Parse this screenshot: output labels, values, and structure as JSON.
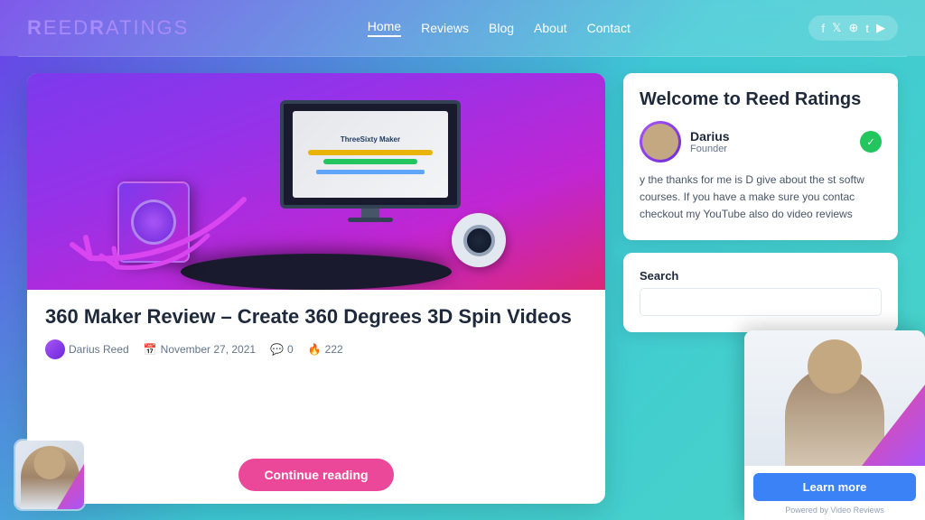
{
  "header": {
    "logo_text": "ReedRatings",
    "nav_items": [
      {
        "label": "Home",
        "active": true
      },
      {
        "label": "Reviews",
        "active": false
      },
      {
        "label": "Blog",
        "active": false
      },
      {
        "label": "About",
        "active": false
      },
      {
        "label": "Contact",
        "active": false
      }
    ],
    "social_icons": [
      "f",
      "t",
      "p",
      "T",
      "▶"
    ]
  },
  "article": {
    "title": "360 Maker Review – Create 360 Degrees 3D Spin Videos",
    "author": "Darius Reed",
    "date": "November 27, 2021",
    "comments": "0",
    "views": "222",
    "continue_btn": "Continue reading"
  },
  "sidebar": {
    "welcome_title": "Welcome to Reed Ratings",
    "author_name": "Darius",
    "author_role": "Founder",
    "bio_text": "y the thanks for me is D give about the st softw courses. If you have a make sure you contac checkout my YouTube also do video reviews",
    "search_label": "Search",
    "search_placeholder": ""
  },
  "video_popup": {
    "learn_more_label": "Learn more",
    "powered_text": "Powered by Video Reviews"
  }
}
